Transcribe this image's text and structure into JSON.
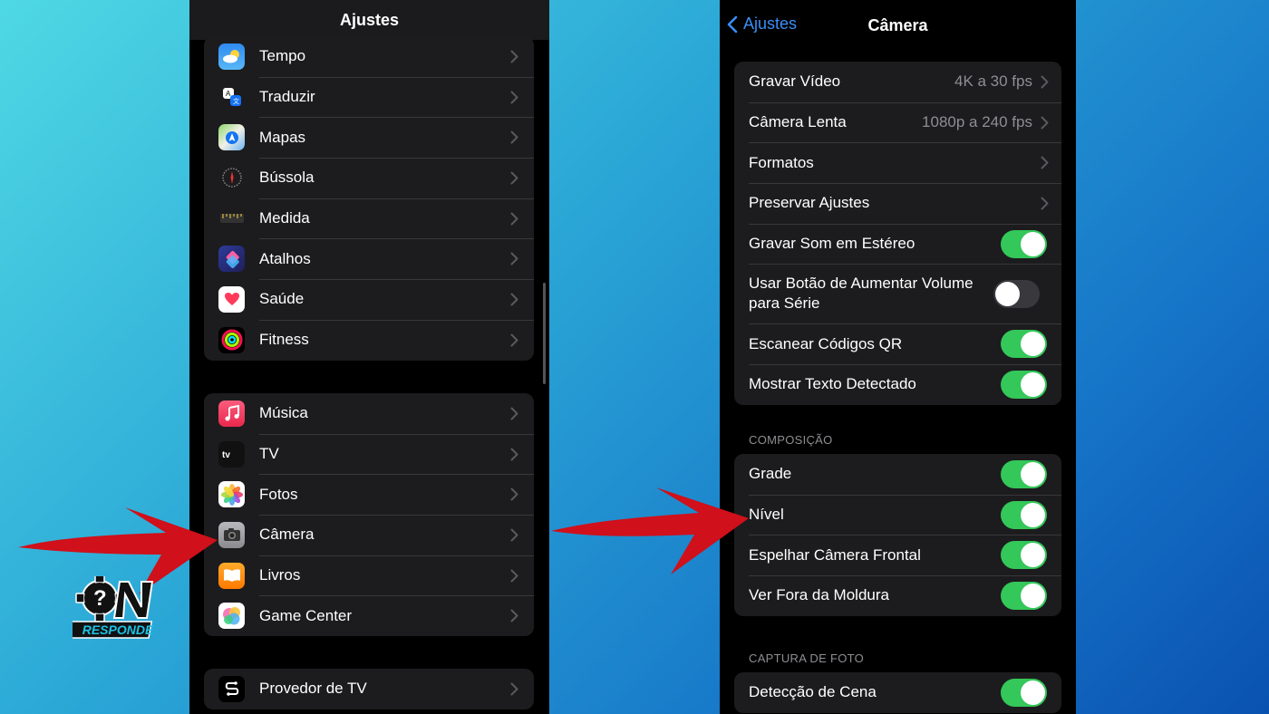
{
  "left_panel": {
    "title": "Ajustes",
    "group1": [
      {
        "label": "Tempo",
        "icon": "weather-icon"
      },
      {
        "label": "Traduzir",
        "icon": "translate-icon"
      },
      {
        "label": "Mapas",
        "icon": "maps-icon"
      },
      {
        "label": "Bússola",
        "icon": "compass-icon"
      },
      {
        "label": "Medida",
        "icon": "measure-icon"
      },
      {
        "label": "Atalhos",
        "icon": "shortcuts-icon"
      },
      {
        "label": "Saúde",
        "icon": "health-icon"
      },
      {
        "label": "Fitness",
        "icon": "fitness-icon"
      }
    ],
    "group2": [
      {
        "label": "Música",
        "icon": "music-icon"
      },
      {
        "label": "TV",
        "icon": "tv-icon"
      },
      {
        "label": "Fotos",
        "icon": "photos-icon"
      },
      {
        "label": "Câmera",
        "icon": "camera-icon"
      },
      {
        "label": "Livros",
        "icon": "books-icon"
      },
      {
        "label": "Game Center",
        "icon": "game-center-icon"
      }
    ],
    "group3": [
      {
        "label": "Provedor de TV",
        "icon": "tv-provider-icon"
      }
    ]
  },
  "right_panel": {
    "back_label": "Ajustes",
    "title": "Câmera",
    "group1": [
      {
        "label": "Gravar Vídeo",
        "value": "4K a 30 fps",
        "type": "nav"
      },
      {
        "label": "Câmera Lenta",
        "value": "1080p a 240 fps",
        "type": "nav"
      },
      {
        "label": "Formatos",
        "value": "",
        "type": "nav"
      },
      {
        "label": "Preservar Ajustes",
        "value": "",
        "type": "nav"
      },
      {
        "label": "Gravar Som em Estéreo",
        "type": "toggle",
        "on": true
      },
      {
        "label": "Usar Botão de Aumentar Volume para Série",
        "type": "toggle",
        "on": false
      },
      {
        "label": "Escanear Códigos QR",
        "type": "toggle",
        "on": true
      },
      {
        "label": "Mostrar Texto Detectado",
        "type": "toggle",
        "on": true
      }
    ],
    "section_composicao": "COMPOSIÇÃO",
    "group2": [
      {
        "label": "Grade",
        "type": "toggle",
        "on": true
      },
      {
        "label": "Nível",
        "type": "toggle",
        "on": true
      },
      {
        "label": "Espelhar Câmera Frontal",
        "type": "toggle",
        "on": true
      },
      {
        "label": "Ver Fora da Moldura",
        "type": "toggle",
        "on": true
      }
    ],
    "section_captura": "CAPTURA DE FOTO",
    "group3": [
      {
        "label": "Detecção de Cena",
        "type": "toggle",
        "on": true
      }
    ]
  },
  "logo": {
    "text": "RESPONDE"
  },
  "colors": {
    "accent": "#3a8ef6",
    "toggle_on": "#34c759",
    "arrow": "#d0101a"
  }
}
